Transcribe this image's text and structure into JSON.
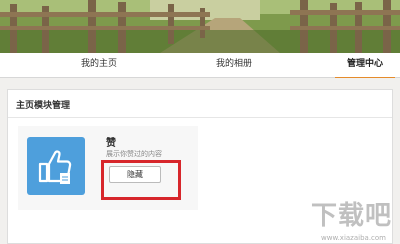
{
  "tabs": [
    {
      "label": "我的主页",
      "active": false
    },
    {
      "label": "我的相册",
      "active": false
    },
    {
      "label": "管理中心",
      "active": true
    }
  ],
  "panel": {
    "title": "主页模块管理"
  },
  "module": {
    "name": "赞",
    "description": "展示你赞过的内容",
    "hide_label": "隐藏",
    "icon": "thumbs-up-icon"
  },
  "watermark": {
    "text": "下载吧",
    "url": "www.xiazaiba.com"
  },
  "colors": {
    "accent": "#e58b2b",
    "icon_tile": "#4e9fdc",
    "highlight": "#d7262b"
  }
}
